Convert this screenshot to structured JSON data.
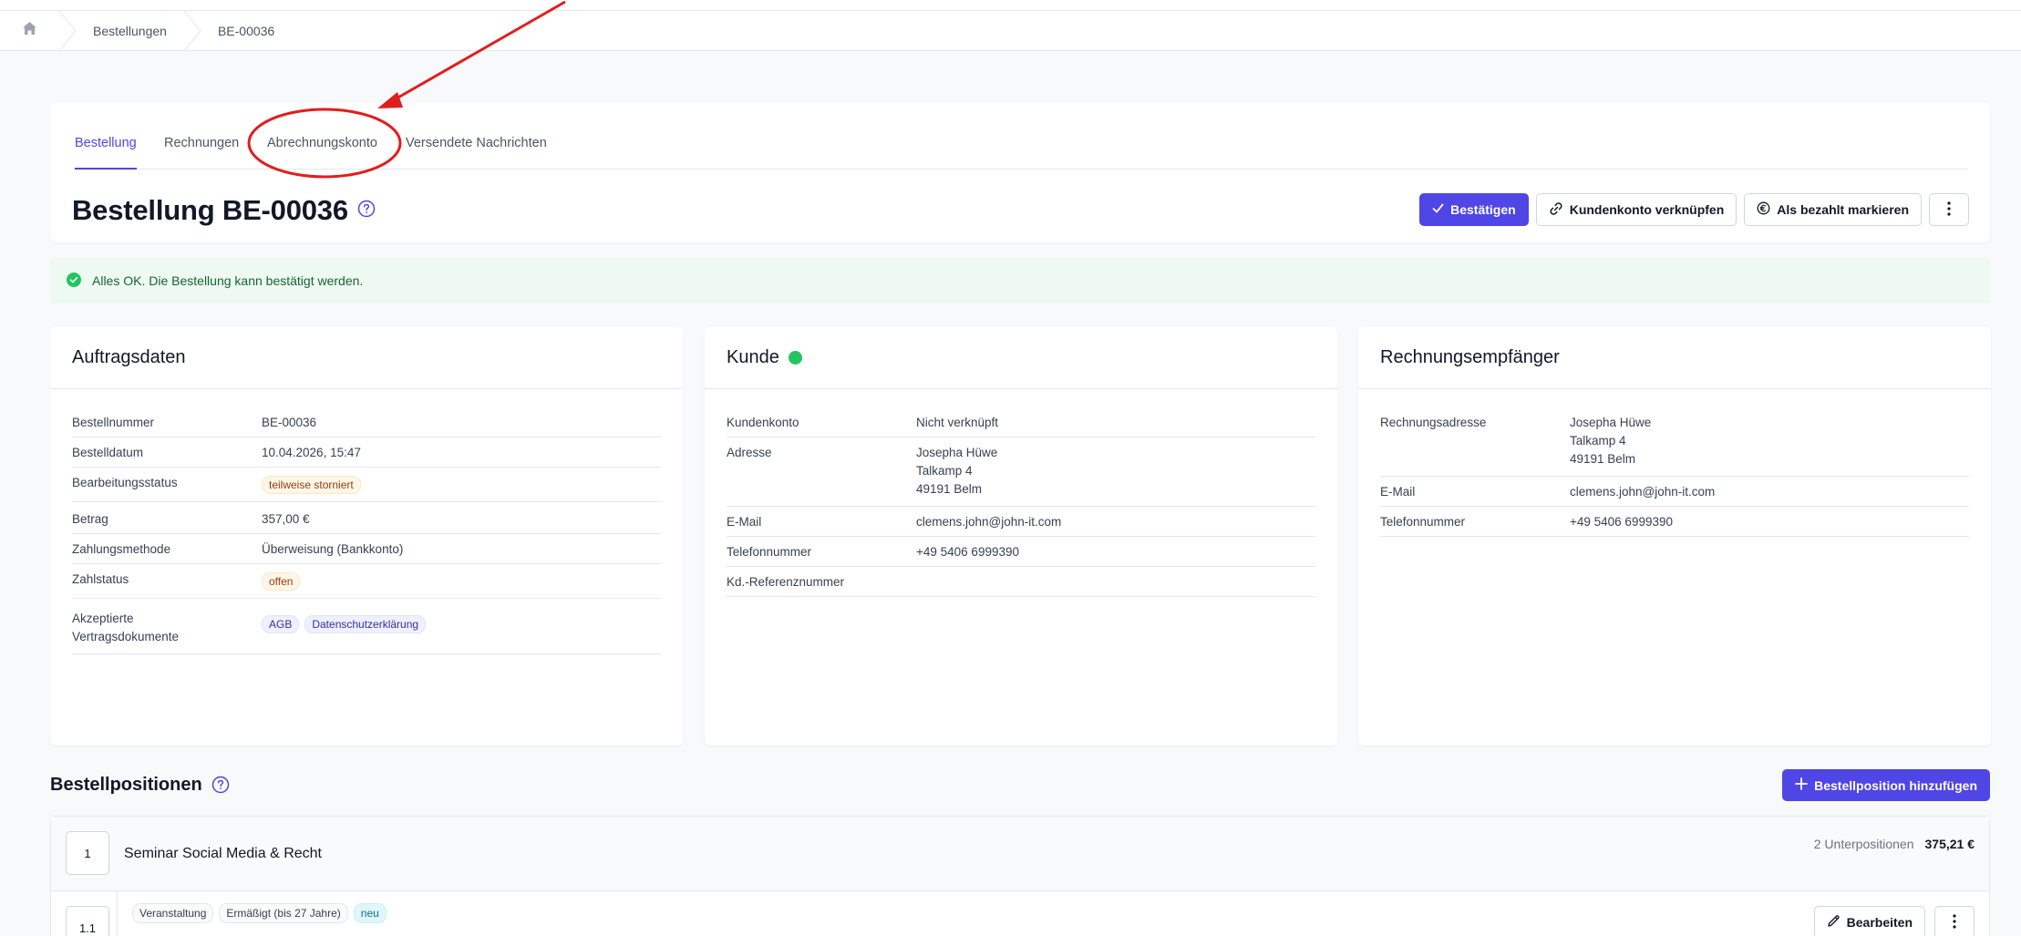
{
  "breadcrumb": {
    "items": [
      "Bestellungen",
      "BE-00036"
    ]
  },
  "tabs": [
    "Bestellung",
    "Rechnungen",
    "Abrechnungskonto",
    "Versendete Nachrichten"
  ],
  "page": {
    "title": "Bestellung BE-00036"
  },
  "actions": {
    "confirm": "Bestätigen",
    "link_account": "Kundenkonto verknüpfen",
    "mark_paid": "Als bezahlt markieren"
  },
  "alert": {
    "text": "Alles OK. Die Bestellung kann bestätigt werden."
  },
  "auftrag": {
    "title": "Auftragsdaten",
    "rows": [
      {
        "k": "Bestellnummer",
        "v": "BE-00036"
      },
      {
        "k": "Bestelldatum",
        "v": "10.04.2026, 15:47"
      },
      {
        "k": "Bearbeitungsstatus",
        "v": "teilweise storniert"
      },
      {
        "k": "Betrag",
        "v": "357,00 €"
      },
      {
        "k": "Zahlungsmethode",
        "v": "Überweisung (Bankkonto)"
      },
      {
        "k": "Zahlstatus",
        "v": "offen"
      },
      {
        "k": "Akzeptierte Vertragsdokumente",
        "v1": "AGB",
        "v2": "Datenschutzerklärung"
      }
    ]
  },
  "kunde": {
    "title": "Kunde",
    "rows": [
      {
        "k": "Kundenkonto",
        "v": "Nicht verknüpft"
      },
      {
        "k": "Adresse",
        "v1": "Josepha Hüwe",
        "v2": "Talkamp 4",
        "v3": "49191 Belm"
      },
      {
        "k": "E-Mail",
        "v": "clemens.john@john-it.com"
      },
      {
        "k": "Telefonnummer",
        "v": "+49 5406 6999390"
      },
      {
        "k": "Kd.-Referenznummer",
        "v": ""
      }
    ]
  },
  "empfaenger": {
    "title": "Rechnungsempfänger",
    "rows": [
      {
        "k": "Rechnungsadresse",
        "v1": "Josepha Hüwe",
        "v2": "Talkamp 4",
        "v3": "49191 Belm"
      },
      {
        "k": "E-Mail",
        "v": "clemens.john@john-it.com"
      },
      {
        "k": "Telefonnummer",
        "v": "+49 5406 6999390"
      }
    ]
  },
  "positionen": {
    "title": "Bestellpositionen",
    "add_label": "Bestellposition hinzufügen",
    "item": {
      "num": "1",
      "name": "Seminar Social Media & Recht",
      "sub_count": "2 Unterpositionen",
      "price": "375,21 €"
    },
    "sub": {
      "num": "1.1",
      "chips": [
        "Veranstaltung",
        "Ermäßigt (bis 27 Jahre)",
        "neu"
      ],
      "edit_label": "Bearbeiten"
    }
  },
  "colors": {
    "accent": "#4f46e5",
    "success": "#22c55e",
    "annotation": "#e11d1d"
  }
}
